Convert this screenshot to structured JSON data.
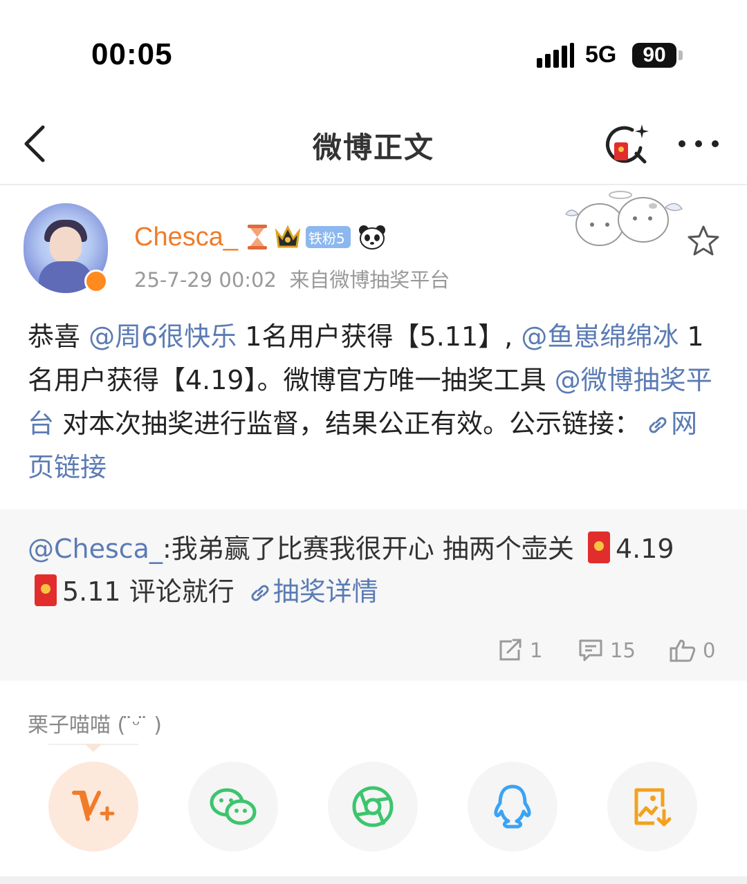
{
  "status_bar": {
    "time": "00:05",
    "network": "5G",
    "battery": "90"
  },
  "nav": {
    "title": "微博正文"
  },
  "post": {
    "username": "Chesca_",
    "fan_badge": "铁粉5",
    "time": "25-7-29 00:02",
    "source": "来自微博抽奖平台",
    "text_parts": {
      "p1": "恭喜 ",
      "m1": "@周6很快乐",
      "p2": " 1名用户获得【5.11】, ",
      "m2": "@鱼崽绵绵冰",
      "p3": " 1名用户获得【4.19】。微博官方唯一抽奖工具 ",
      "m3": "@微博抽奖平台",
      "p4": " 对本次抽奖进行监督，结果公正有效。公示链接：",
      "link": "网页链接"
    }
  },
  "repost": {
    "author": "@Chesca_",
    "text1": ":我弟赢了比赛我很开心 抽两个壶关 ",
    "v1": "4.19",
    "v2": "5.11 评论就行 ",
    "link": "抽奖详情",
    "stats": {
      "reposts": "1",
      "comments": "15",
      "likes": "0"
    }
  },
  "comment_hint": {
    "user": "栗子喵喵 ( ̈ᵕ ̈ )"
  },
  "colors": {
    "accent_orange": "#f07c2a",
    "link_blue": "#5b7bb4",
    "wechat_green": "#3cc56d",
    "qq_blue": "#3aa3f5",
    "save_orange": "#f2a21f"
  }
}
